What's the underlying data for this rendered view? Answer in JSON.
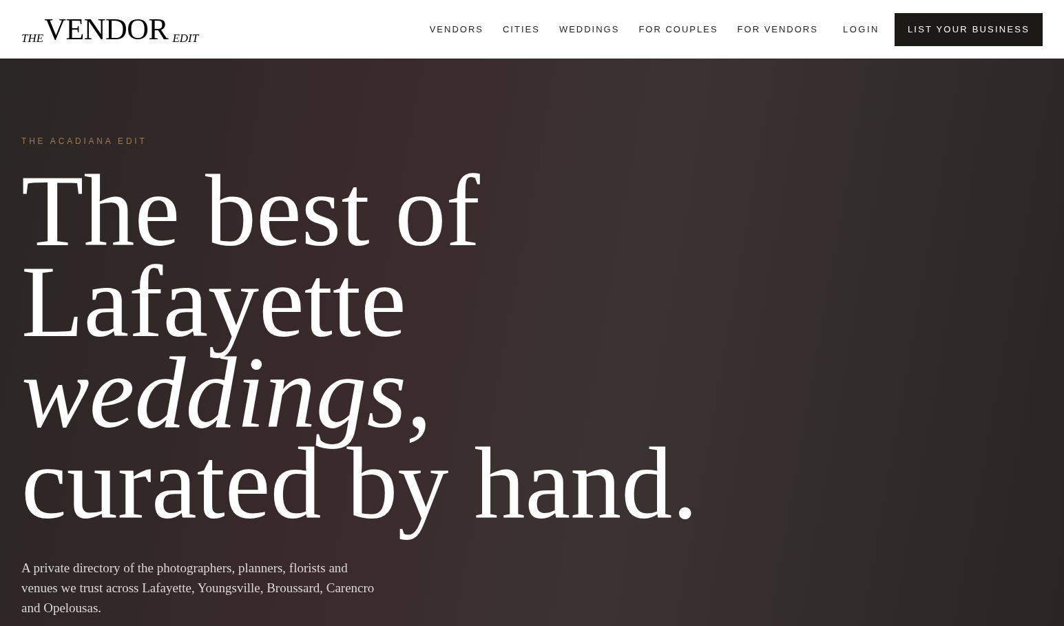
{
  "header": {
    "logo": {
      "prefix": "THE",
      "name": "VENDOR",
      "suffix": "EDIT"
    },
    "nav": [
      {
        "label": "VENDORS"
      },
      {
        "label": "CITIES"
      },
      {
        "label": "WEDDINGS"
      },
      {
        "label": "FOR COUPLES"
      },
      {
        "label": "FOR VENDORS"
      }
    ],
    "login": "LOGIN",
    "cta": "LIST YOUR BUSINESS"
  },
  "hero": {
    "eyebrow": "THE ACADIANA EDIT",
    "headline": [
      "The best of",
      "Lafayette",
      "*weddings,*",
      "curated by hand."
    ],
    "description": "A private directory of the photographers, planners, florists and venues we trust across Lafayette, Youngsville, Broussard, Carencro and Opelousas."
  }
}
